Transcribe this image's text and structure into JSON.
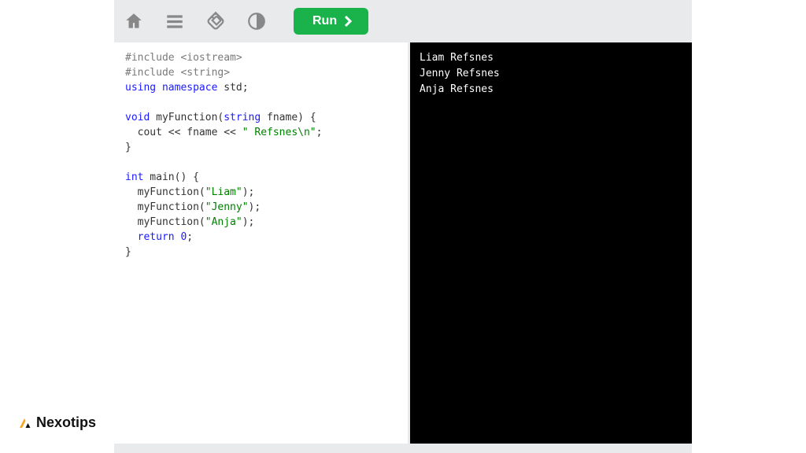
{
  "toolbar": {
    "run_label": "Run"
  },
  "code": {
    "lines": [
      [
        {
          "c": "pp",
          "t": "#include <iostream>"
        }
      ],
      [
        {
          "c": "pp",
          "t": "#include <string>"
        }
      ],
      [
        {
          "c": "kw",
          "t": "using"
        },
        {
          "t": " "
        },
        {
          "c": "kw",
          "t": "namespace"
        },
        {
          "t": " std;"
        }
      ],
      [
        {
          "t": ""
        }
      ],
      [
        {
          "c": "kw",
          "t": "void"
        },
        {
          "t": " myFunction("
        },
        {
          "c": "kw",
          "t": "string"
        },
        {
          "t": " fname) {"
        }
      ],
      [
        {
          "t": "  cout << fname << "
        },
        {
          "c": "str",
          "t": "\" Refsnes\\n\""
        },
        {
          "t": ";"
        }
      ],
      [
        {
          "t": "}"
        }
      ],
      [
        {
          "t": ""
        }
      ],
      [
        {
          "c": "kw",
          "t": "int"
        },
        {
          "t": " main() {"
        }
      ],
      [
        {
          "t": "  myFunction("
        },
        {
          "c": "str",
          "t": "\"Liam\""
        },
        {
          "t": ");"
        }
      ],
      [
        {
          "t": "  myFunction("
        },
        {
          "c": "str",
          "t": "\"Jenny\""
        },
        {
          "t": ");"
        }
      ],
      [
        {
          "t": "  myFunction("
        },
        {
          "c": "str",
          "t": "\"Anja\""
        },
        {
          "t": ");"
        }
      ],
      [
        {
          "t": "  "
        },
        {
          "c": "kw",
          "t": "return"
        },
        {
          "t": " "
        },
        {
          "c": "kw",
          "t": "0"
        },
        {
          "t": ";"
        }
      ],
      [
        {
          "t": "}"
        }
      ]
    ]
  },
  "output": {
    "lines": [
      "Liam Refsnes",
      "Jenny Refsnes",
      "Anja Refsnes"
    ]
  },
  "brand": {
    "name": "Nexotips"
  }
}
